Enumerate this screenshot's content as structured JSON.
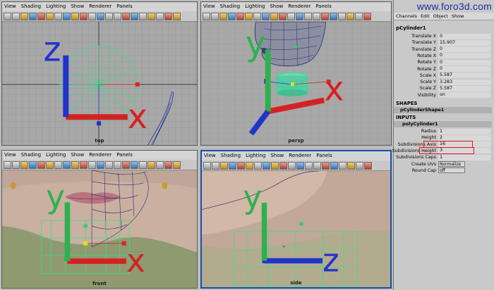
{
  "menu": [
    "View",
    "Shading",
    "Lighting",
    "Show",
    "Renderer",
    "Panels"
  ],
  "viewports": {
    "top": {
      "label": "top"
    },
    "persp": {
      "label": "persp"
    },
    "front": {
      "label": "front"
    },
    "side": {
      "label": "side"
    }
  },
  "axes": {
    "x": "x",
    "y": "y",
    "z": "z"
  },
  "site": "www.foro3d.com",
  "channel_box": {
    "menu": [
      "Channels",
      "Edit",
      "Object",
      "Show"
    ],
    "object_name": "pCylinder1",
    "transform": [
      {
        "label": "Translate X",
        "value": "0"
      },
      {
        "label": "Translate Y",
        "value": "15.907"
      },
      {
        "label": "Translate Z",
        "value": "0"
      },
      {
        "label": "Rotate X",
        "value": "0"
      },
      {
        "label": "Rotate Y",
        "value": "0"
      },
      {
        "label": "Rotate Z",
        "value": "0"
      },
      {
        "label": "Scale X",
        "value": "5.587"
      },
      {
        "label": "Scale Y",
        "value": "3.283"
      },
      {
        "label": "Scale Z",
        "value": "5.587"
      },
      {
        "label": "Visibility",
        "value": "on"
      }
    ],
    "shapes_title": "SHAPES",
    "shape_name": "pCylinderShape1",
    "inputs_title": "INPUTS",
    "input_name": "polyCylinder1",
    "inputs": [
      {
        "label": "Radius",
        "value": "1"
      },
      {
        "label": "Height",
        "value": "2"
      },
      {
        "label": "Subdivisions Axis",
        "value": "16"
      },
      {
        "label": "Subdivisions Height",
        "value": "3"
      },
      {
        "label": "Subdivisions Caps",
        "value": "1"
      }
    ],
    "create_uvs": {
      "label": "Create UVs",
      "value": "Normalize a"
    },
    "round_cap": {
      "label": "Round Cap",
      "value": "off"
    }
  }
}
